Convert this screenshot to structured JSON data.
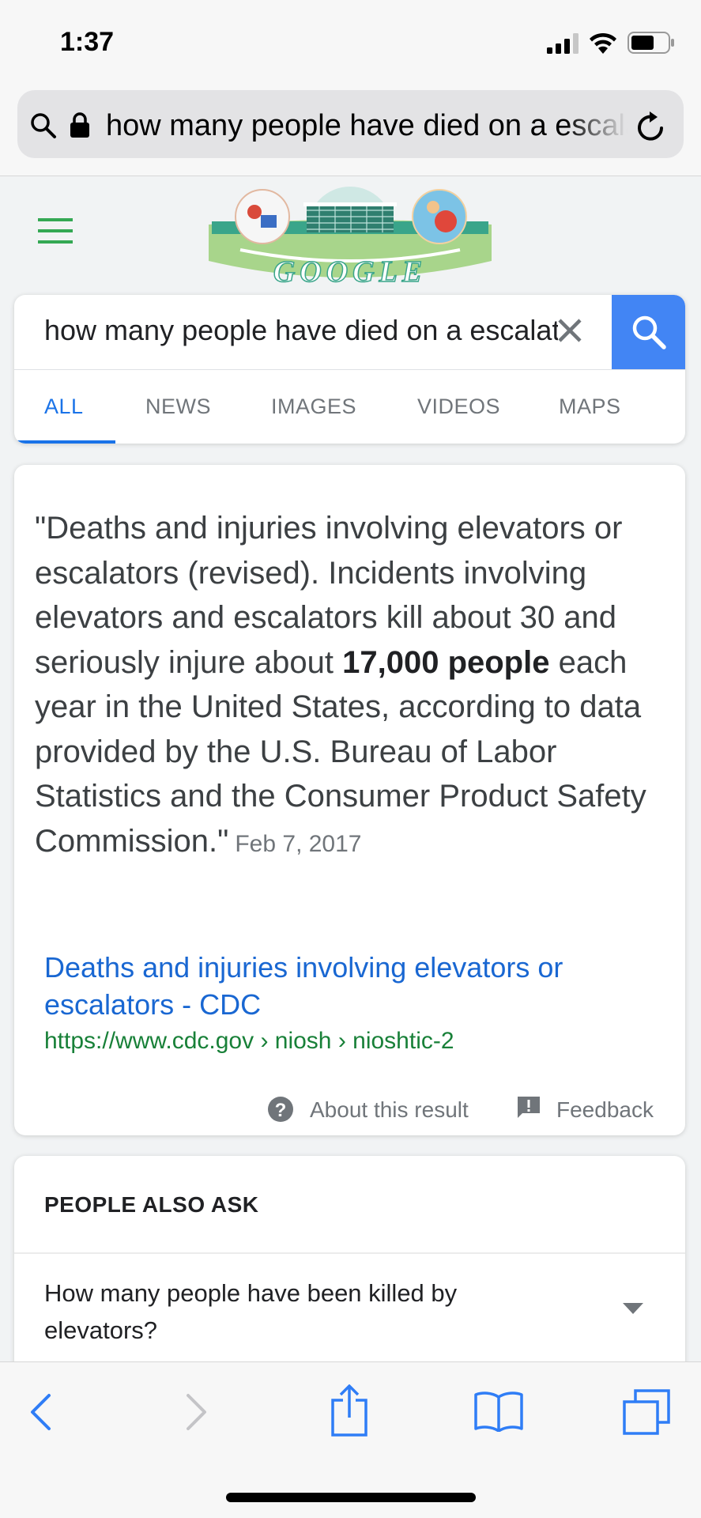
{
  "status_bar": {
    "time": "1:37"
  },
  "url_bar": {
    "text": "how many people have died on a escalator"
  },
  "doodle": {
    "label": "GOOGLE"
  },
  "search": {
    "query": "how many people have died on a escalator",
    "tabs": [
      {
        "label": "ALL",
        "active": true
      },
      {
        "label": "NEWS",
        "active": false
      },
      {
        "label": "IMAGES",
        "active": false
      },
      {
        "label": "VIDEOS",
        "active": false
      },
      {
        "label": "MAPS",
        "active": false
      }
    ]
  },
  "featured_snippet": {
    "quote_open": "\"",
    "text_part1": "Deaths and injuries involving elevators or escalators (revised). Incidents involving elevators and escalators kill about 30 and seriously injure about ",
    "bold": "17,000 people",
    "text_part2": " each year in the United States, according to data provided by the U.S. Bureau of Labor Statistics and the Consumer Product Safety Commission.\"",
    "date": "Feb 7, 2017",
    "title": "Deaths and injuries involving elevators or escalators - CDC",
    "url": "https://www.cdc.gov › niosh › nioshtic-2",
    "about_label": "About this result",
    "feedback_label": "Feedback"
  },
  "people_also_ask": {
    "heading": "PEOPLE ALSO ASK",
    "questions": [
      "How many people have been killed by elevators?"
    ]
  },
  "colors": {
    "accent_blue": "#4285f4",
    "link_blue": "#1967d2",
    "url_green": "#188038",
    "menu_green": "#34a853"
  }
}
